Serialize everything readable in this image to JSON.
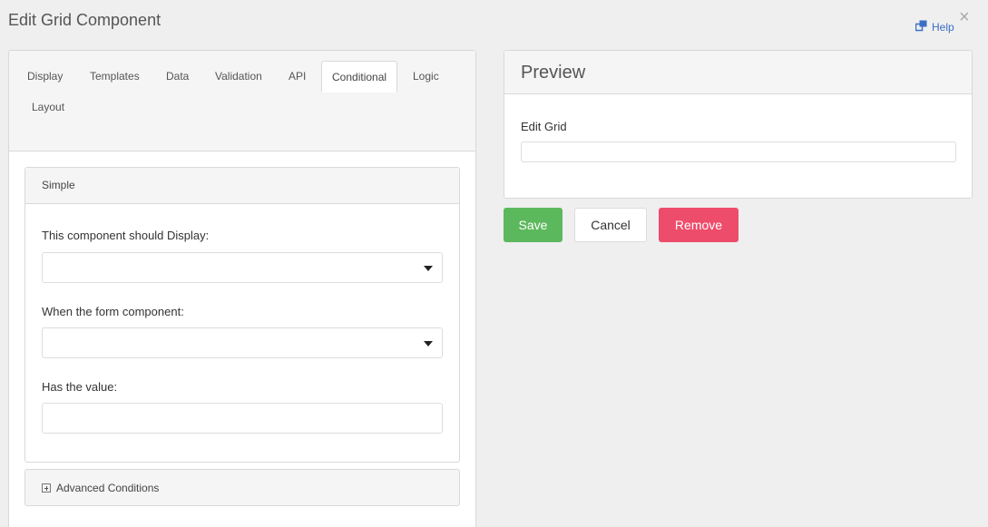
{
  "modal": {
    "title": "Edit Grid Component",
    "help_label": "Help",
    "close_glyph": "×"
  },
  "tabs": [
    {
      "label": "Display"
    },
    {
      "label": "Templates"
    },
    {
      "label": "Data"
    },
    {
      "label": "Validation"
    },
    {
      "label": "API"
    },
    {
      "label": "Conditional",
      "active": true
    },
    {
      "label": "Logic"
    },
    {
      "label": "Layout"
    }
  ],
  "simple": {
    "header": "Simple",
    "display_label": "This component should Display:",
    "display_value": "",
    "when_label": "When the form component:",
    "when_value": "",
    "value_label": "Has the value:",
    "value_value": ""
  },
  "advanced": {
    "label": "Advanced Conditions",
    "icon": "plus-square-icon"
  },
  "preview": {
    "header": "Preview",
    "field_label": "Edit Grid",
    "field_value": ""
  },
  "actions": {
    "save": "Save",
    "cancel": "Cancel",
    "remove": "Remove"
  },
  "colors": {
    "save": "#5cb85c",
    "remove": "#ee4c6b",
    "link": "#3a6fc4"
  }
}
